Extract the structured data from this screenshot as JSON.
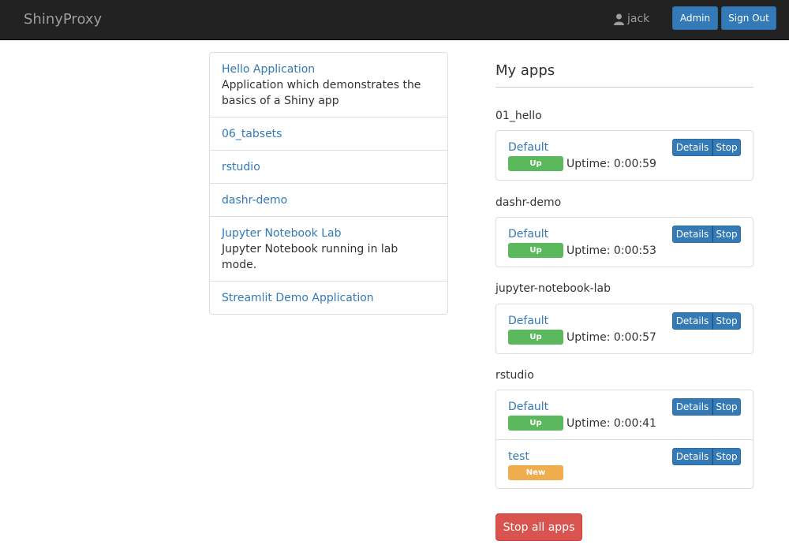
{
  "navbar": {
    "brand": "ShinyProxy",
    "user": "jack",
    "admin_label": "Admin",
    "signout_label": "Sign Out"
  },
  "apps": [
    {
      "name": "Hello Application",
      "description": "Application which demonstrates the basics of a Shiny app"
    },
    {
      "name": "06_tabsets",
      "description": ""
    },
    {
      "name": "rstudio",
      "description": ""
    },
    {
      "name": "dashr-demo",
      "description": ""
    },
    {
      "name": "Jupyter Notebook Lab",
      "description": "Jupyter Notebook running in lab mode."
    },
    {
      "name": "Streamlit Demo Application",
      "description": ""
    }
  ],
  "my_apps": {
    "title": "My apps",
    "groups": [
      {
        "title": "01_hello",
        "instances": [
          {
            "name": "Default",
            "status": "Up",
            "uptime": "Uptime: 0:00:59"
          }
        ]
      },
      {
        "title": "dashr-demo",
        "instances": [
          {
            "name": "Default",
            "status": "Up",
            "uptime": "Uptime: 0:00:53"
          }
        ]
      },
      {
        "title": "jupyter-notebook-lab",
        "instances": [
          {
            "name": "Default",
            "status": "Up",
            "uptime": "Uptime: 0:00:57"
          }
        ]
      },
      {
        "title": "rstudio",
        "instances": [
          {
            "name": "Default",
            "status": "Up",
            "uptime": "Uptime: 0:00:41"
          },
          {
            "name": "test",
            "status": "New",
            "uptime": ""
          }
        ]
      }
    ],
    "details_label": "Details",
    "stop_label": "Stop",
    "stop_all_label": "Stop all apps"
  },
  "colors": {
    "navbar": "#222222",
    "primary": "#337ab7",
    "success": "#5cb85c",
    "warning": "#f0ad4e",
    "danger": "#d9534f"
  }
}
